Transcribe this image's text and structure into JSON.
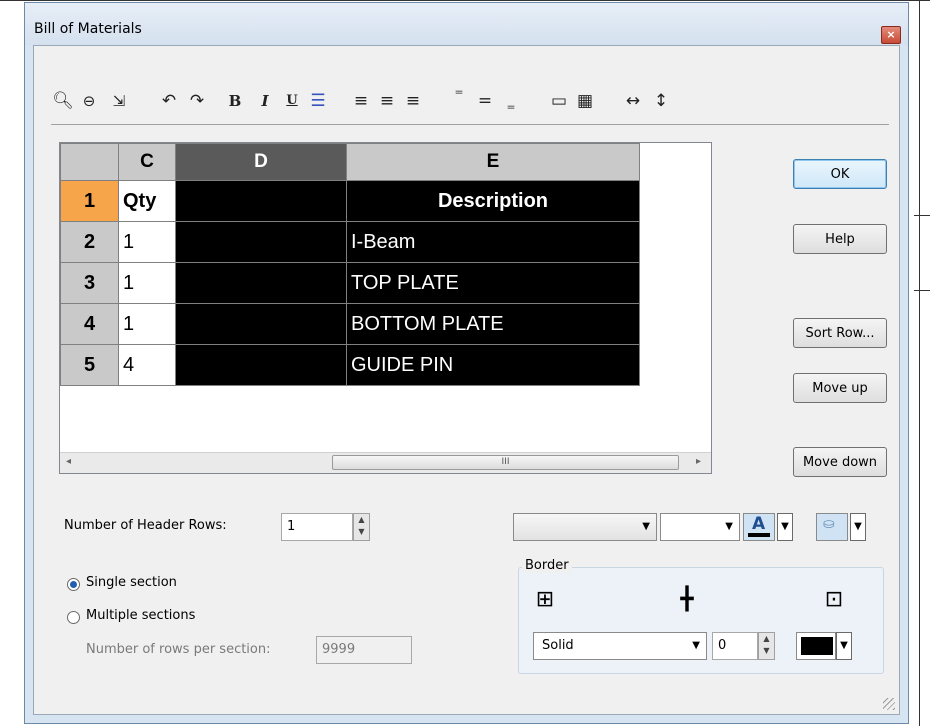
{
  "window": {
    "title": "Bill of Materials",
    "close_glyph": "×"
  },
  "toolbar": {
    "icons": [
      "zoom-in-icon",
      "zoom-out-icon",
      "insert-icon",
      "undo-icon",
      "redo-icon",
      "bold-icon",
      "italic-icon",
      "underline-icon",
      "line-style-icon",
      "align-left-icon",
      "align-center-icon",
      "align-right-icon",
      "align-top-icon",
      "align-middle-icon",
      "align-bottom-icon",
      "column-icon",
      "table-icon",
      "fit-width-icon",
      "fit-height-icon"
    ],
    "bold": "B",
    "italic": "I",
    "underline": "U"
  },
  "sheet": {
    "columns": [
      "C",
      "D",
      "E"
    ],
    "rows": [
      {
        "num": "1",
        "qty": "Qty",
        "d": "",
        "e": "Description"
      },
      {
        "num": "2",
        "qty": "1",
        "d": "",
        "e": "I-Beam"
      },
      {
        "num": "3",
        "qty": "1",
        "d": "",
        "e": "TOP PLATE"
      },
      {
        "num": "4",
        "qty": "1",
        "d": "",
        "e": "BOTTOM PLATE"
      },
      {
        "num": "5",
        "qty": "4",
        "d": "",
        "e": "GUIDE PIN"
      }
    ],
    "scroll_grip": "III"
  },
  "buttons": {
    "ok": "OK",
    "help": "Help",
    "sort_row": "Sort Row...",
    "move_up": "Move up",
    "move_down": "Move down"
  },
  "header_rows": {
    "label": "Number of Header Rows:",
    "value": "1"
  },
  "sections": {
    "single": "Single section",
    "multiple": "Multiple sections",
    "rows_per_section_label": "Number of rows per section:",
    "rows_per_section_value": "9999",
    "selected": "single"
  },
  "format": {
    "font_combo": "",
    "size_combo": ""
  },
  "border": {
    "title": "Border",
    "style": "Solid",
    "width": "0",
    "color": "#000000"
  },
  "colors": {
    "text_color": "#000000",
    "fill_color": "#9ac3e6",
    "accent": "#f7a54a"
  }
}
